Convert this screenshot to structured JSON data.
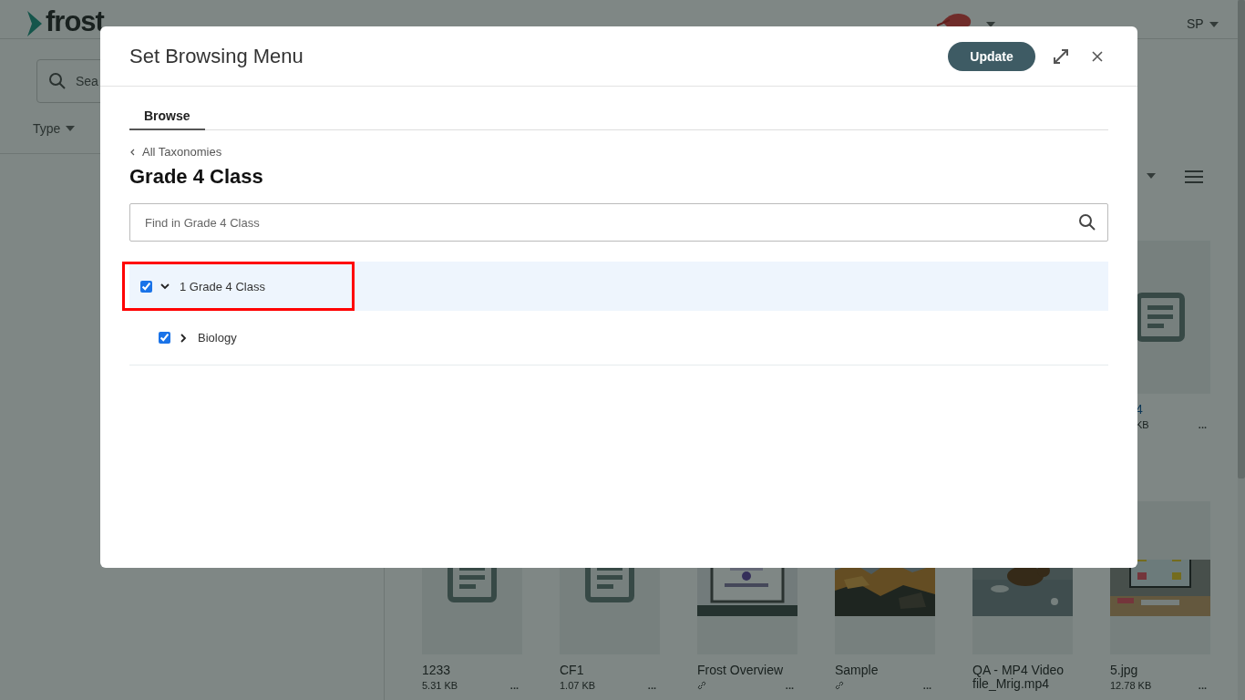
{
  "header": {
    "logo_bold": "frost",
    "user": "SP"
  },
  "filters": {
    "search_placeholder": "Sea",
    "type_filter": "Type"
  },
  "cards_row_1": [
    {
      "name": "4",
      "size": "KB",
      "kind": "document",
      "menu": "..."
    }
  ],
  "cards_row_2": [
    {
      "name": "1233",
      "size": "5.31 KB",
      "kind": "document",
      "linked": false,
      "menu": "..."
    },
    {
      "name": "CF1",
      "size": "1.07 KB",
      "kind": "document",
      "linked": false,
      "menu": "..."
    },
    {
      "name": "Frost Overview",
      "kind": "picture",
      "linked": true,
      "menu": "..."
    },
    {
      "name": "Sample",
      "kind": "picture",
      "linked": true,
      "menu": "..."
    },
    {
      "name": "QA - MP4 Video file_Mrig.mp4",
      "kind": "picture",
      "linked": false
    },
    {
      "name": "5.jpg",
      "size": "12.78 KB",
      "kind": "picture",
      "linked": false,
      "menu": "..."
    }
  ],
  "modal": {
    "title": "Set Browsing Menu",
    "update_button": "Update",
    "tabs": [
      {
        "label": "Browse",
        "selected": true
      }
    ],
    "back_link": "All Taxonomies",
    "heading": "Grade 4 Class",
    "search_placeholder": "Find in Grade 4 Class",
    "tree": [
      {
        "label": "1 Grade 4 Class",
        "checked": true,
        "expanded": true,
        "active": true,
        "highlighted": true,
        "children": [
          {
            "label": "Biology",
            "checked": true,
            "expanded": false,
            "active": false,
            "highlighted": false
          }
        ]
      }
    ]
  }
}
